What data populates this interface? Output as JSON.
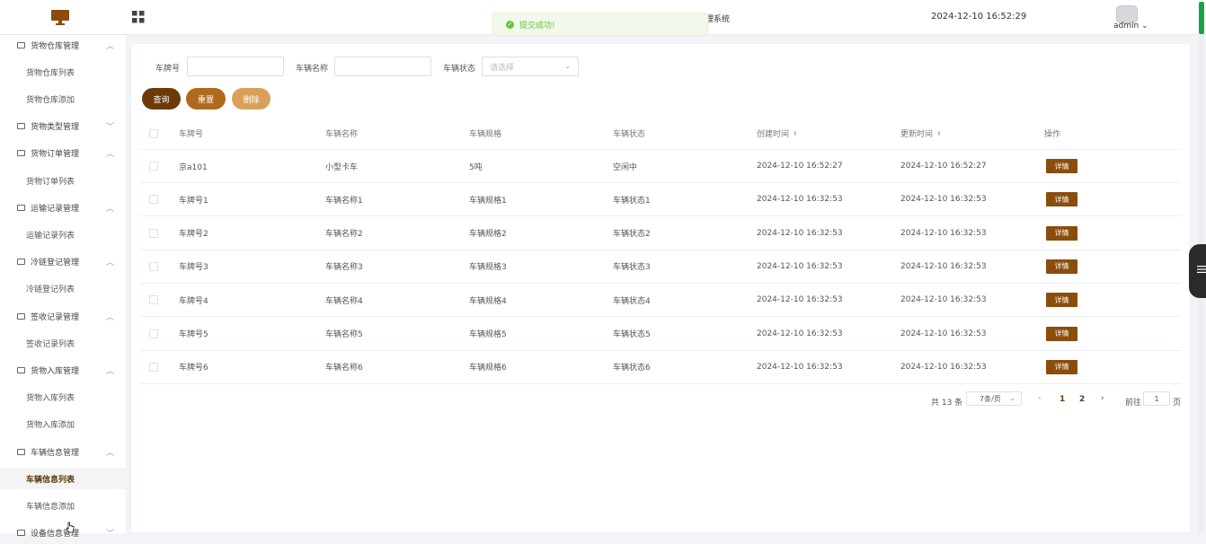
{
  "header": {
    "system_title": "理系统",
    "datetime": "2024-12-10 16:52:29",
    "username": "admin",
    "username_chevron": "⌄",
    "logo_icon": "monitor-icon",
    "apps_icon": "grid-icon"
  },
  "toast": {
    "icon": "✓",
    "message": "提交成功!"
  },
  "sidebar": {
    "items": [
      {
        "type": "group",
        "label": "货物仓库管理",
        "chevron": "︿"
      },
      {
        "type": "sub",
        "label": "货物仓库列表"
      },
      {
        "type": "sub",
        "label": "货物仓库添加"
      },
      {
        "type": "group",
        "label": "货物类型管理",
        "chevron": "﹀"
      },
      {
        "type": "group",
        "label": "货物订单管理",
        "chevron": "︿"
      },
      {
        "type": "sub",
        "label": "货物订单列表"
      },
      {
        "type": "group",
        "label": "运输记录管理",
        "chevron": "︿"
      },
      {
        "type": "sub",
        "label": "运输记录列表"
      },
      {
        "type": "group",
        "label": "冷链登记管理",
        "chevron": "︿"
      },
      {
        "type": "sub",
        "label": "冷链登记列表"
      },
      {
        "type": "group",
        "label": "签收记录管理",
        "chevron": "︿"
      },
      {
        "type": "sub",
        "label": "签收记录列表"
      },
      {
        "type": "group",
        "label": "货物入库管理",
        "chevron": "︿"
      },
      {
        "type": "sub",
        "label": "货物入库列表"
      },
      {
        "type": "sub",
        "label": "货物入库添加"
      },
      {
        "type": "group",
        "label": "车辆信息管理",
        "chevron": "︿"
      },
      {
        "type": "sub",
        "label": "车辆信息列表",
        "active": true
      },
      {
        "type": "sub",
        "label": "车辆信息添加"
      },
      {
        "type": "group",
        "label": "设备信息管理",
        "chevron": "﹀"
      }
    ]
  },
  "filters": {
    "plate_label": "车牌号",
    "plate_value": "",
    "name_label": "车辆名称",
    "name_value": "",
    "status_label": "车辆状态",
    "status_placeholder": "请选择",
    "status_chevron": "⌄"
  },
  "buttons": {
    "query": "查询",
    "reset": "重置",
    "delete": "删除",
    "colors": {
      "query": "#6e3a08",
      "reset": "#b06a1e",
      "delete": "#d9a05a"
    }
  },
  "table": {
    "columns": [
      "车牌号",
      "车辆名称",
      "车辆规格",
      "车辆状态",
      "创建时间",
      "更新时间",
      "操作"
    ],
    "sort_icon": "⬍",
    "detail_label": "详情",
    "rows": [
      [
        "京a101",
        "小型卡车",
        "5吨",
        "空闲中",
        "2024-12-10 16:52:27",
        "2024-12-10 16:52:27"
      ],
      [
        "车牌号1",
        "车辆名称1",
        "车辆规格1",
        "车辆状态1",
        "2024-12-10 16:32:53",
        "2024-12-10 16:32:53"
      ],
      [
        "车牌号2",
        "车辆名称2",
        "车辆规格2",
        "车辆状态2",
        "2024-12-10 16:32:53",
        "2024-12-10 16:32:53"
      ],
      [
        "车牌号3",
        "车辆名称3",
        "车辆规格3",
        "车辆状态3",
        "2024-12-10 16:32:53",
        "2024-12-10 16:32:53"
      ],
      [
        "车牌号4",
        "车辆名称4",
        "车辆规格4",
        "车辆状态4",
        "2024-12-10 16:32:53",
        "2024-12-10 16:32:53"
      ],
      [
        "车牌号5",
        "车辆名称5",
        "车辆规格5",
        "车辆状态5",
        "2024-12-10 16:32:53",
        "2024-12-10 16:32:53"
      ],
      [
        "车牌号6",
        "车辆名称6",
        "车辆规格6",
        "车辆状态6",
        "2024-12-10 16:32:53",
        "2024-12-10 16:32:53"
      ]
    ]
  },
  "pagination": {
    "total": "共 13 条",
    "page_size": "7条/页",
    "size_chevron": "⌄",
    "prev": "‹",
    "next": "›",
    "pages": [
      "1",
      "2"
    ],
    "goto_label": "前往",
    "goto_value": "1",
    "goto_unit": "页"
  },
  "accent_color": "#8b4d0c"
}
